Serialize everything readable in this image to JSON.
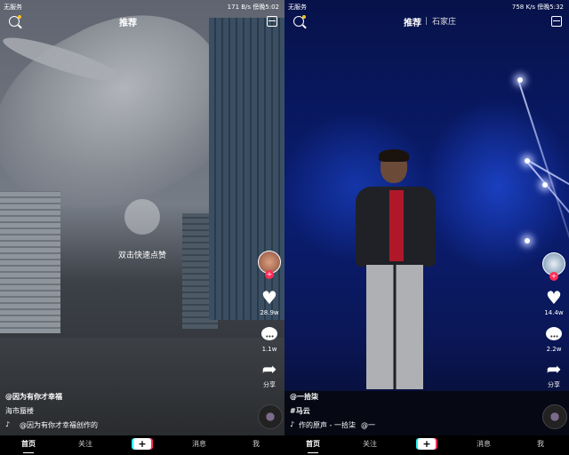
{
  "left": {
    "status": {
      "carrier": "无服务",
      "right": "171 B/s  傍晚5:02"
    },
    "topnav": {
      "tab_active": "推荐"
    },
    "overlay": {
      "double_tap_text": "双击快速点赞"
    },
    "actions": {
      "likes": "28.9w",
      "comments": "1.1w",
      "share": "分享"
    },
    "info": {
      "author": "@因为有你才幸福",
      "caption": "海市蜃楼",
      "music": "@因为有你才幸福创作的"
    },
    "tabbar": {
      "home": "首页",
      "follow": "关注",
      "add": "+",
      "messages": "消息",
      "me": "我"
    }
  },
  "right": {
    "status": {
      "carrier": "无服务",
      "right": "758 K/s  傍晚5:32"
    },
    "topnav": {
      "tab_active": "推荐",
      "tab_city": "石家庄"
    },
    "actions": {
      "likes": "14.4w",
      "comments": "2.2w",
      "share": "分享"
    },
    "info": {
      "author": "@一拾柒",
      "caption": "#马云",
      "music": "作的原声 - 一拾柒",
      "music2": "@一"
    },
    "tabbar": {
      "home": "首页",
      "follow": "关注",
      "add": "+",
      "messages": "消息",
      "me": "我"
    }
  },
  "colors": {
    "accent_red": "#fe2c55",
    "accent_cyan": "#25f4ee",
    "notification_dot": "#fcbf21"
  }
}
